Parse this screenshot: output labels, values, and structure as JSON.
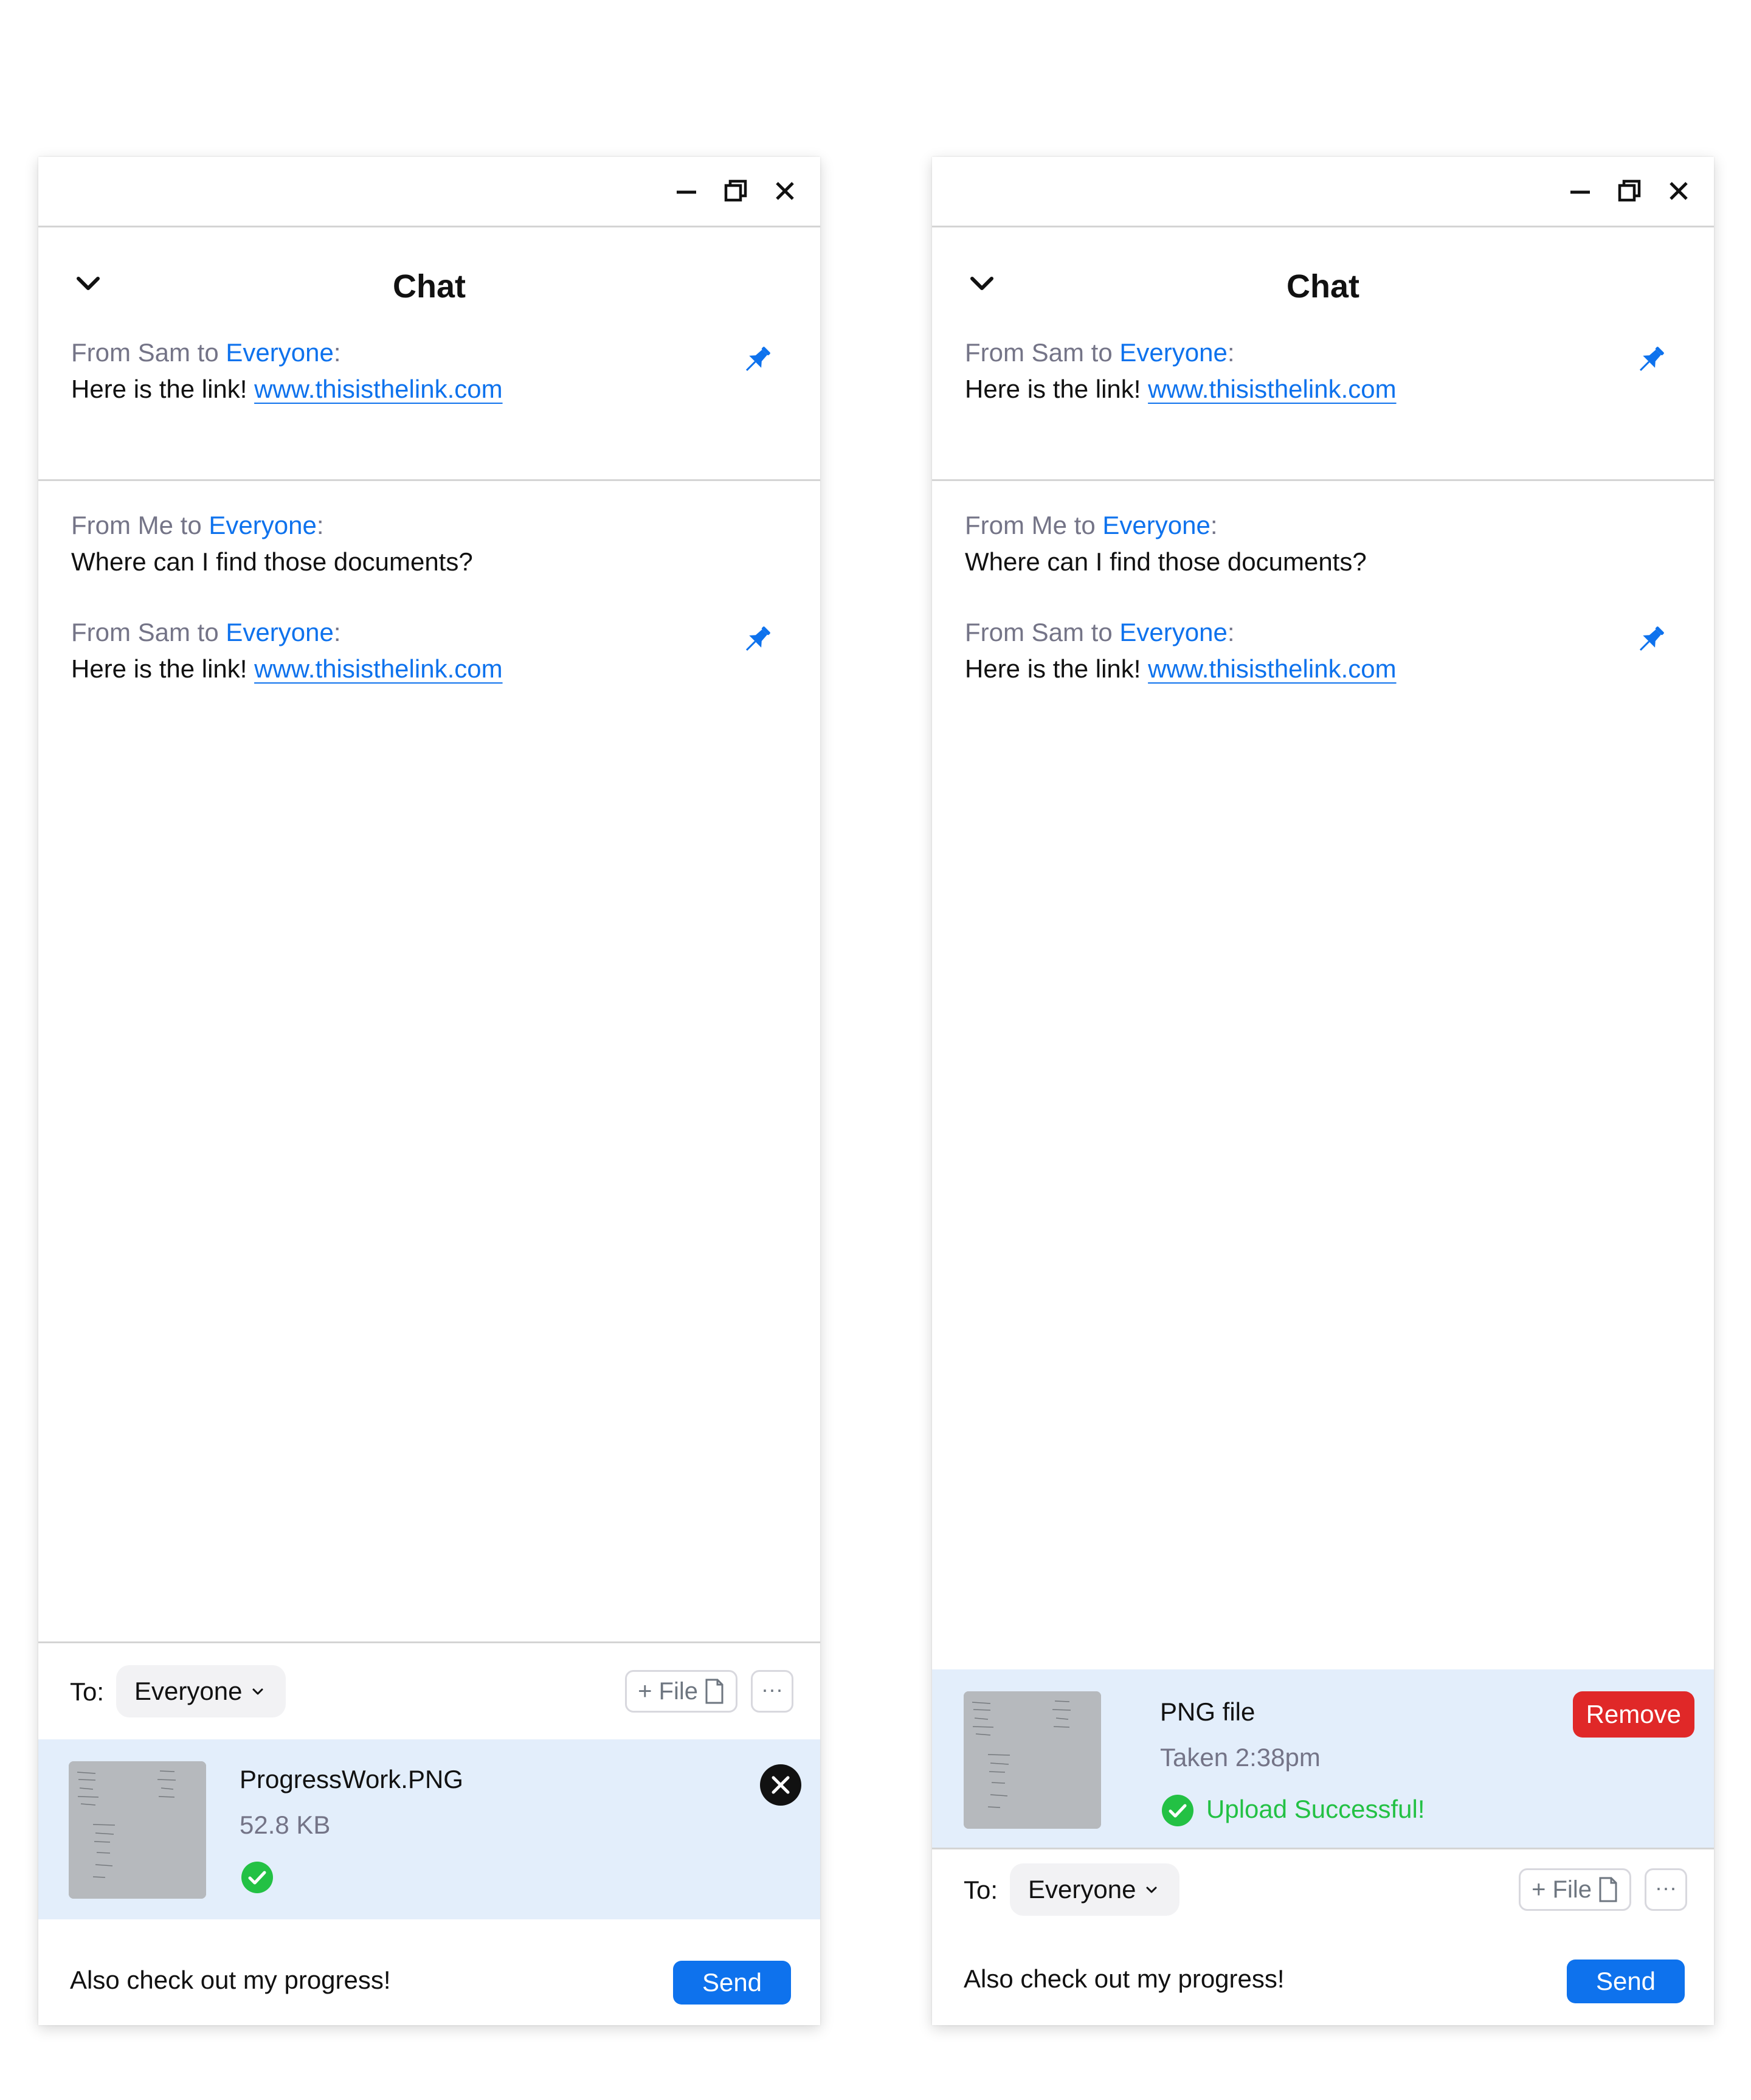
{
  "colors": {
    "accent": "#0e72ed",
    "success": "#23c144",
    "danger": "#e02828",
    "attachment_bg": "#e3eefb"
  },
  "icons": [
    "minimize-icon",
    "restore-icon",
    "close-icon",
    "chevron-down-icon",
    "pin-icon",
    "file-icon",
    "more-icon",
    "remove-icon",
    "check-circle-icon"
  ],
  "left": {
    "title": "Chat",
    "pinned": {
      "from_prefix": "From Sam to ",
      "to": "Everyone",
      "colon": ":",
      "text": "Here is the link! ",
      "link": "www.thisisthelink.com"
    },
    "messages": [
      {
        "from_prefix": "From Me to ",
        "to": "Everyone",
        "colon": ":",
        "text": "Where can I find those documents?"
      },
      {
        "from_prefix": "From Sam to ",
        "to": "Everyone",
        "colon": ":",
        "text": "Here is the link! ",
        "link": "www.thisisthelink.com"
      }
    ],
    "to_label": "To:",
    "to_value": "Everyone",
    "file_button": "+ File",
    "more_button": "···",
    "attachment": {
      "name": "ProgressWork.PNG",
      "size": "52.8 KB"
    },
    "message_text": "Also check out my progress!",
    "send_label": "Send"
  },
  "right": {
    "title": "Chat",
    "pinned": {
      "from_prefix": "From Sam to ",
      "to": "Everyone",
      "colon": ":",
      "text": "Here is the link! ",
      "link": "www.thisisthelink.com"
    },
    "messages": [
      {
        "from_prefix": "From Me to ",
        "to": "Everyone",
        "colon": ":",
        "text": "Where can I find those documents?"
      },
      {
        "from_prefix": "From Sam to ",
        "to": "Everyone",
        "colon": ":",
        "text": "Here is the link! ",
        "link": "www.thisisthelink.com"
      }
    ],
    "attachment": {
      "type_label": "PNG file",
      "taken": "Taken 2:38pm",
      "status": "Upload Successful!",
      "remove_label": "Remove"
    },
    "to_label": "To:",
    "to_value": "Everyone",
    "file_button": "+ File",
    "more_button": "···",
    "message_text": "Also check out my progress!",
    "send_label": "Send"
  }
}
